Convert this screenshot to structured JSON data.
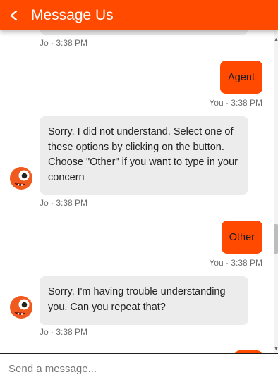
{
  "header": {
    "title": "Message Us",
    "back_icon": "chevron-left-icon",
    "color": "#ff4a00"
  },
  "messages": [
    {
      "sender": "bot",
      "meta": "Jo · 3:38 PM"
    },
    {
      "sender": "user",
      "text": "Agent",
      "meta": "You · 3:38 PM"
    },
    {
      "sender": "bot",
      "text": "Sorry. I did not understand. Select one of these options by clicking on the button. Choose \"Other\" if you want to type in your concern",
      "meta": "Jo · 3:38 PM"
    },
    {
      "sender": "user",
      "text": "Other",
      "meta": "You · 3:38 PM"
    },
    {
      "sender": "bot",
      "text": "Sorry, I'm having trouble understanding you. Can you repeat that?",
      "meta": "Jo · 3:38 PM"
    }
  ],
  "composer": {
    "placeholder": "Send a message..."
  },
  "colors": {
    "accent": "#ff4a00",
    "bot_bubble": "#ececec"
  }
}
